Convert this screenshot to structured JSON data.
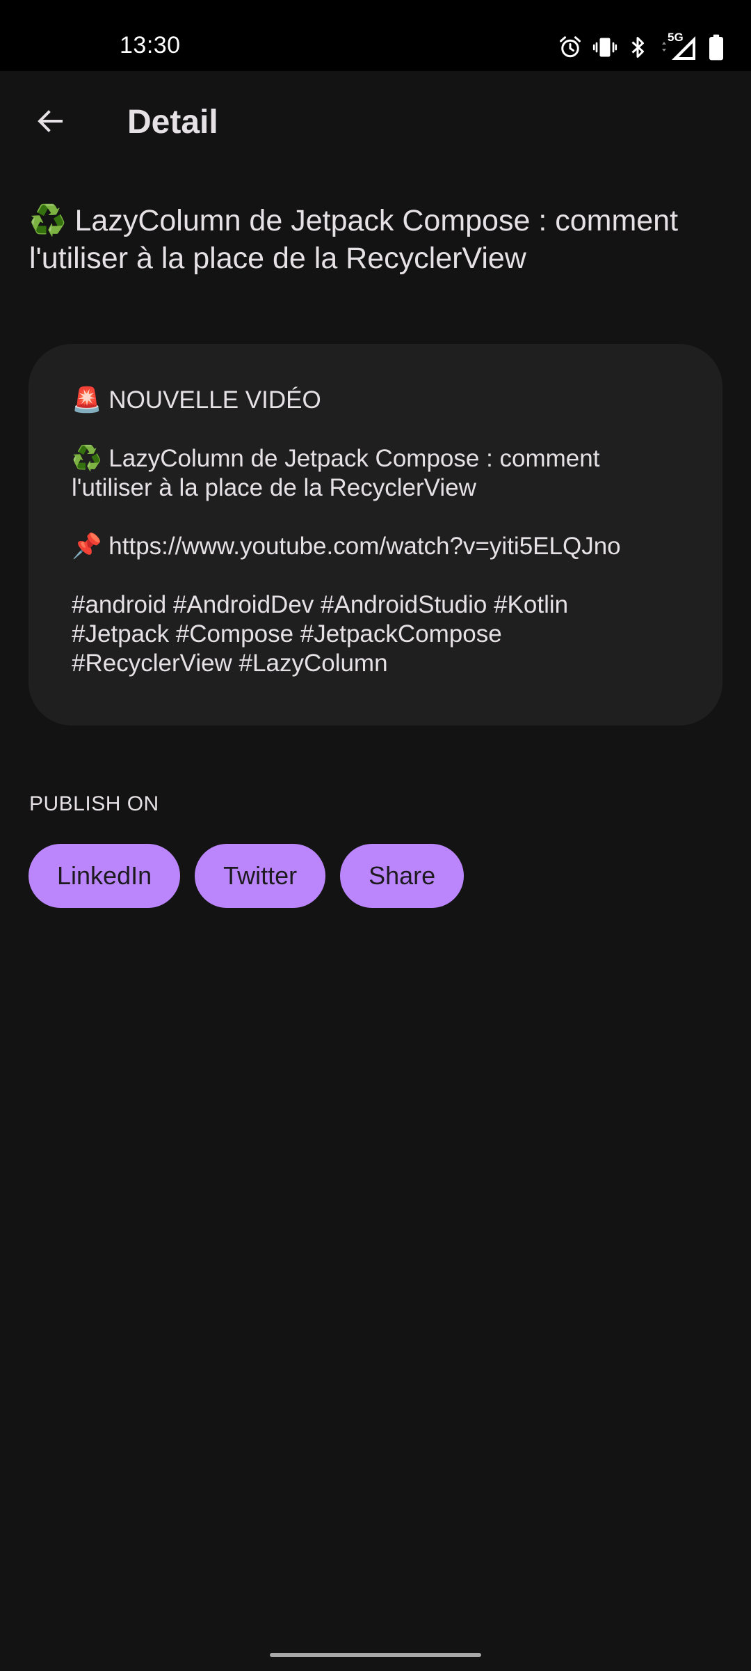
{
  "status_bar": {
    "time": "13:30",
    "network_label": "5G",
    "icons": [
      "alarm-icon",
      "vibrate-icon",
      "bluetooth-icon",
      "data-arrows-icon",
      "signal-icon",
      "battery-icon"
    ]
  },
  "app_bar": {
    "title": "Detail",
    "back_icon": "arrow-back-icon"
  },
  "post": {
    "title": "♻️ LazyColumn de Jetpack Compose : comment l'utiliser à la place de la RecyclerView",
    "content": {
      "heading": "🚨 NOUVELLE VIDÉO",
      "title_line_1": "♻️ LazyColumn de Jetpack Compose : comment",
      "title_line_2": "l'utiliser à la place de la RecyclerView",
      "link": "📌 https://www.youtube.com/watch?v=yiti5ELQJno",
      "hashtags_line_1": "#android #AndroidDev #AndroidStudio #Kotlin",
      "hashtags_line_2": "#Jetpack #Compose #JetpackCompose",
      "hashtags_line_3": "#RecyclerView #LazyColumn"
    }
  },
  "publish": {
    "label": "PUBLISH ON",
    "buttons": {
      "linkedin": "LinkedIn",
      "twitter": "Twitter",
      "share": "Share"
    }
  },
  "colors": {
    "background": "#131313",
    "card": "#1f1f1f",
    "accent": "#bb86fc",
    "text": "#e6e1e5"
  }
}
